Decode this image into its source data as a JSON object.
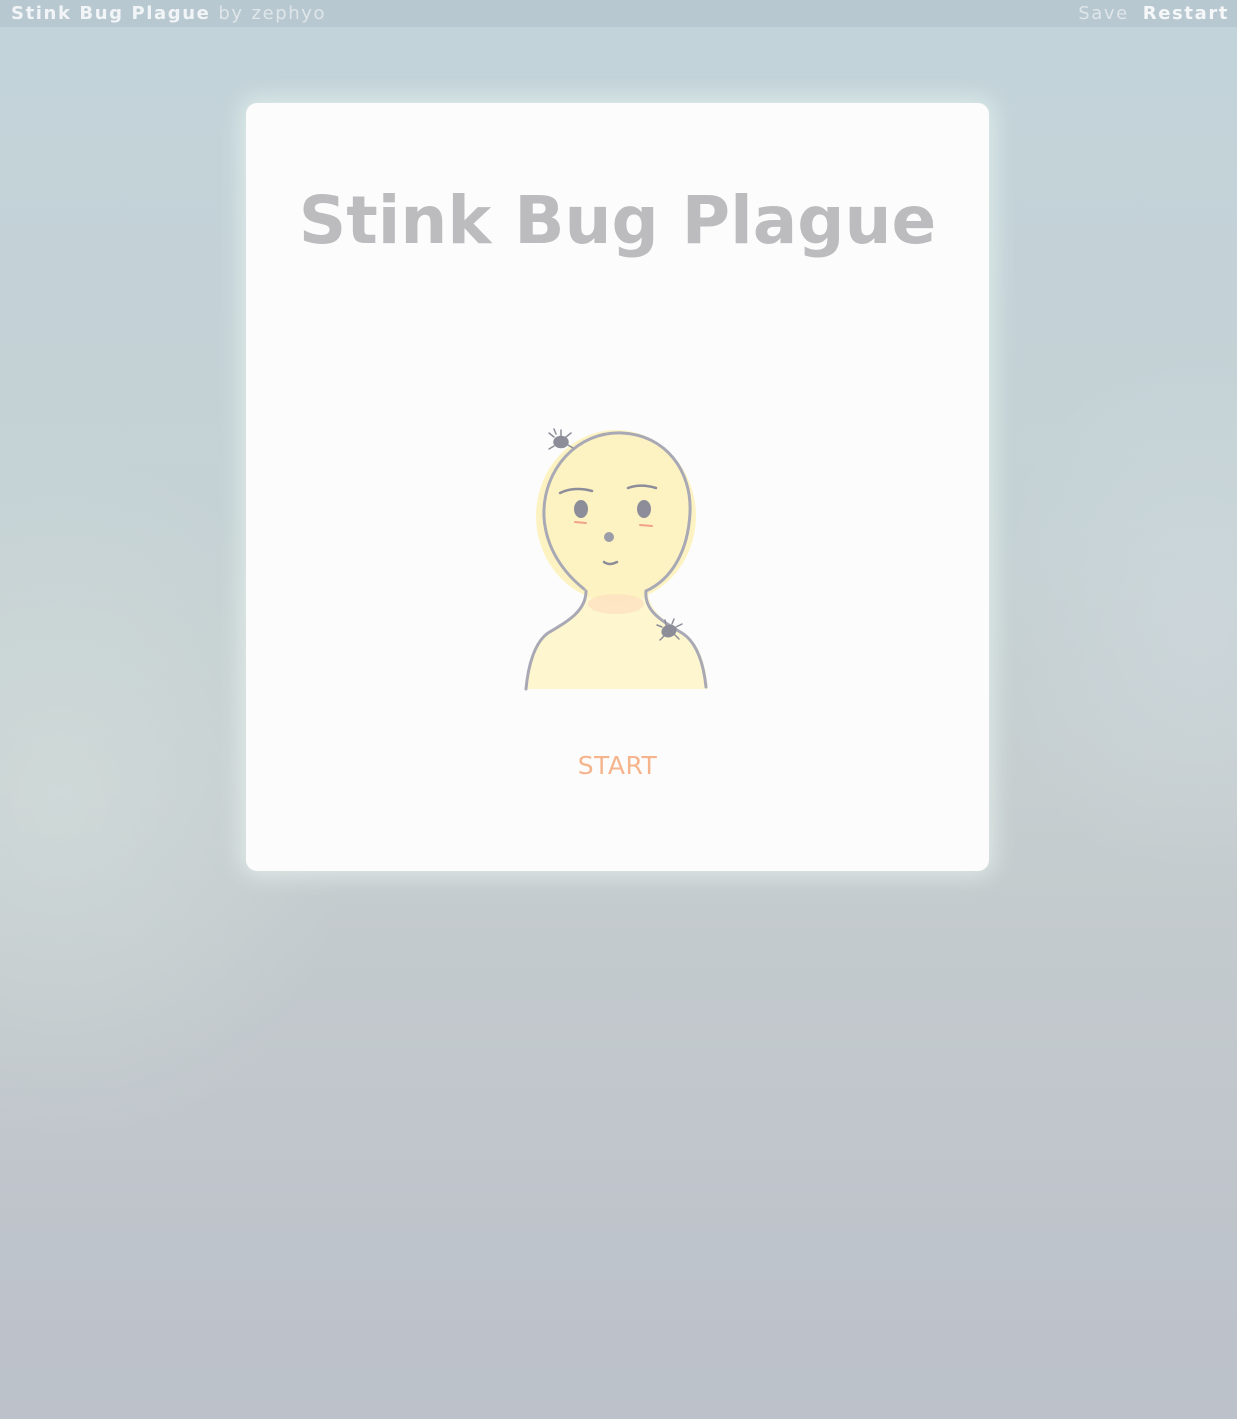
{
  "topbar": {
    "game_title": "Stink Bug Plague",
    "by": "by",
    "author": "zephyo",
    "save_label": "Save",
    "restart_label": "Restart"
  },
  "card": {
    "title": "Stink Bug Plague",
    "start_label": "START",
    "cover_image": "character-portrait-with-stink-bugs"
  },
  "colors": {
    "background": "#c4d2d6",
    "card": "#fcfcfc",
    "title_text": "#bcbcbf",
    "start_text": "#f6b48d",
    "skin": "#fdf5c6"
  }
}
